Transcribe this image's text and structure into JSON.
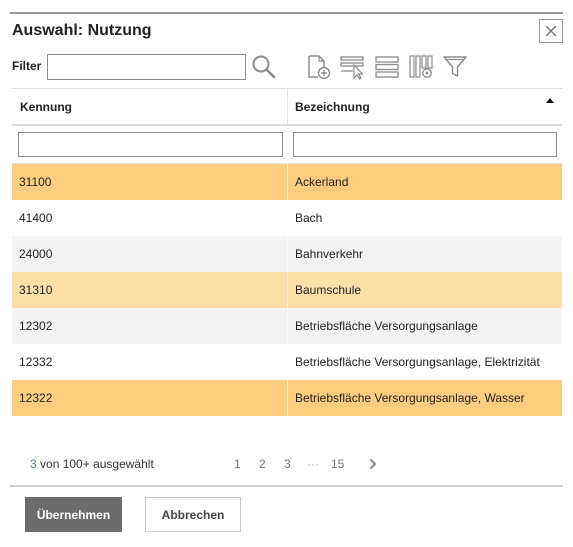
{
  "dialog": {
    "title": "Auswahl: Nutzung"
  },
  "filter": {
    "label": "Filter",
    "value": "",
    "placeholder": ""
  },
  "toolbar_icons": [
    "search-icon",
    "add-document-icon",
    "select-rows-icon",
    "list-view-icon",
    "column-settings-icon",
    "filter-funnel-icon"
  ],
  "table": {
    "columns": [
      {
        "label": "Kennung",
        "filter_value": ""
      },
      {
        "label": "Bezeichnung",
        "filter_value": "",
        "sort": "ascending"
      }
    ],
    "rows": [
      {
        "kennung": "31100",
        "bezeichnung": "Ackerland",
        "state": "selected"
      },
      {
        "kennung": "41400",
        "bezeichnung": "Bach",
        "state": "normal"
      },
      {
        "kennung": "24000",
        "bezeichnung": "Bahnverkehr",
        "state": "normal"
      },
      {
        "kennung": "31310",
        "bezeichnung": "Baumschule",
        "state": "hover"
      },
      {
        "kennung": "12302",
        "bezeichnung": "Betriebsfläche Versorgungsanlage",
        "state": "normal"
      },
      {
        "kennung": "12332",
        "bezeichnung": "Betriebsfläche Versorgungsanlage, Elektrizität",
        "state": "normal"
      },
      {
        "kennung": "12322",
        "bezeichnung": "Betriebsfläche Versorgungsanlage, Wasser",
        "state": "selected"
      }
    ]
  },
  "pagination": {
    "selected_count": "3",
    "selected_text": " von 100+ ausgewählt",
    "pages": [
      "1",
      "2",
      "3",
      "···",
      "15"
    ],
    "next_icon": "chevron-right-icon"
  },
  "buttons": {
    "apply": "Übernehmen",
    "cancel": "Abbrechen"
  },
  "colors": {
    "selected_row": "#fdcd7f",
    "hover_row": "#fde0a8",
    "primary_button": "#6c6c6c"
  }
}
